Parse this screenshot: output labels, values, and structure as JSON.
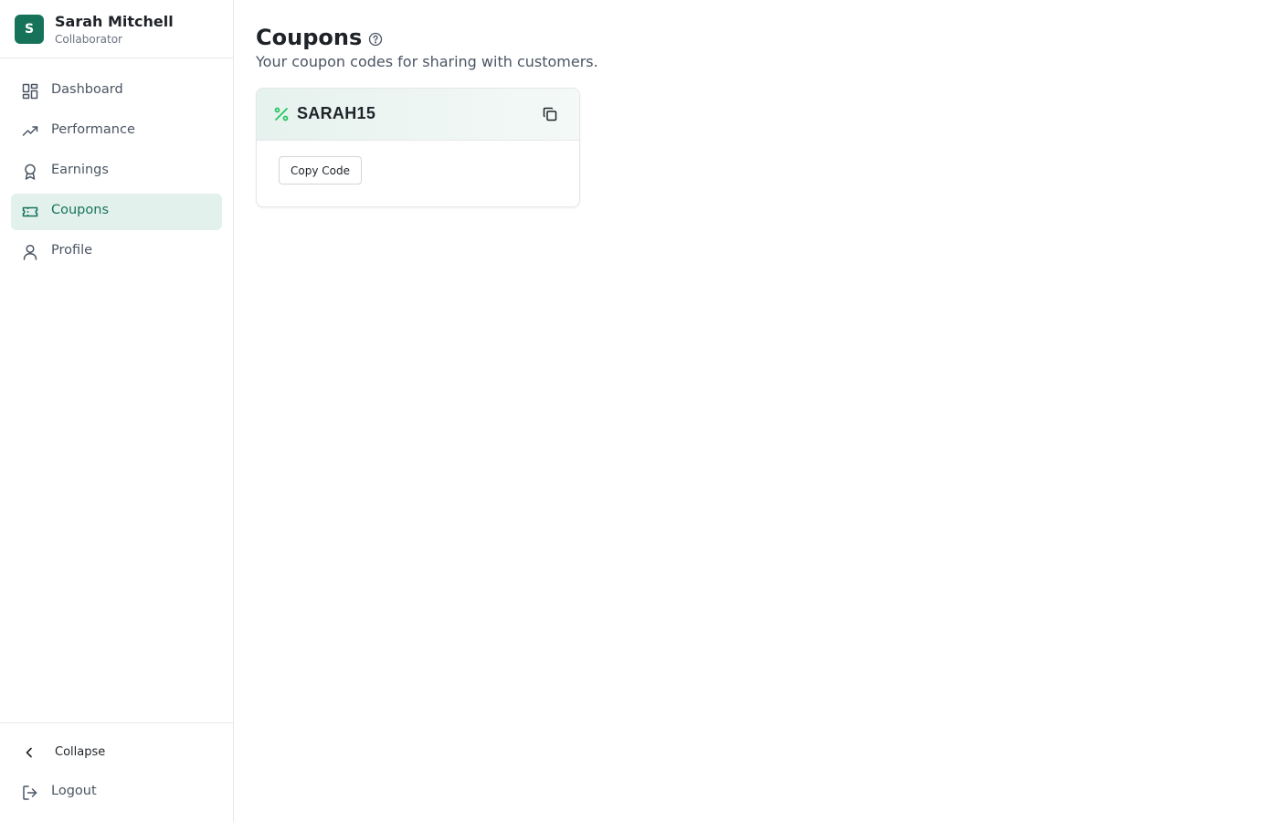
{
  "user": {
    "initial": "S",
    "name": "Sarah Mitchell",
    "role": "Collaborator",
    "avatar_color": "#16735a"
  },
  "sidebar": {
    "items": [
      {
        "label": "Dashboard",
        "icon": "dashboard-grid-icon",
        "active": false
      },
      {
        "label": "Performance",
        "icon": "trending-up-icon",
        "active": false
      },
      {
        "label": "Earnings",
        "icon": "award-icon",
        "active": false
      },
      {
        "label": "Coupons",
        "icon": "ticket-icon",
        "active": true
      },
      {
        "label": "Profile",
        "icon": "user-icon",
        "active": false
      }
    ],
    "collapse_label": "Collapse",
    "logout_label": "Logout"
  },
  "page": {
    "title": "Coupons",
    "subtitle": "Your coupon codes for sharing with customers."
  },
  "coupons": [
    {
      "code": "SARAH15",
      "copy_label": "Copy Code"
    }
  ],
  "colors": {
    "accent": "#16735a",
    "active_bg": "#e3f1ed",
    "percent_icon": "#22c55e"
  }
}
